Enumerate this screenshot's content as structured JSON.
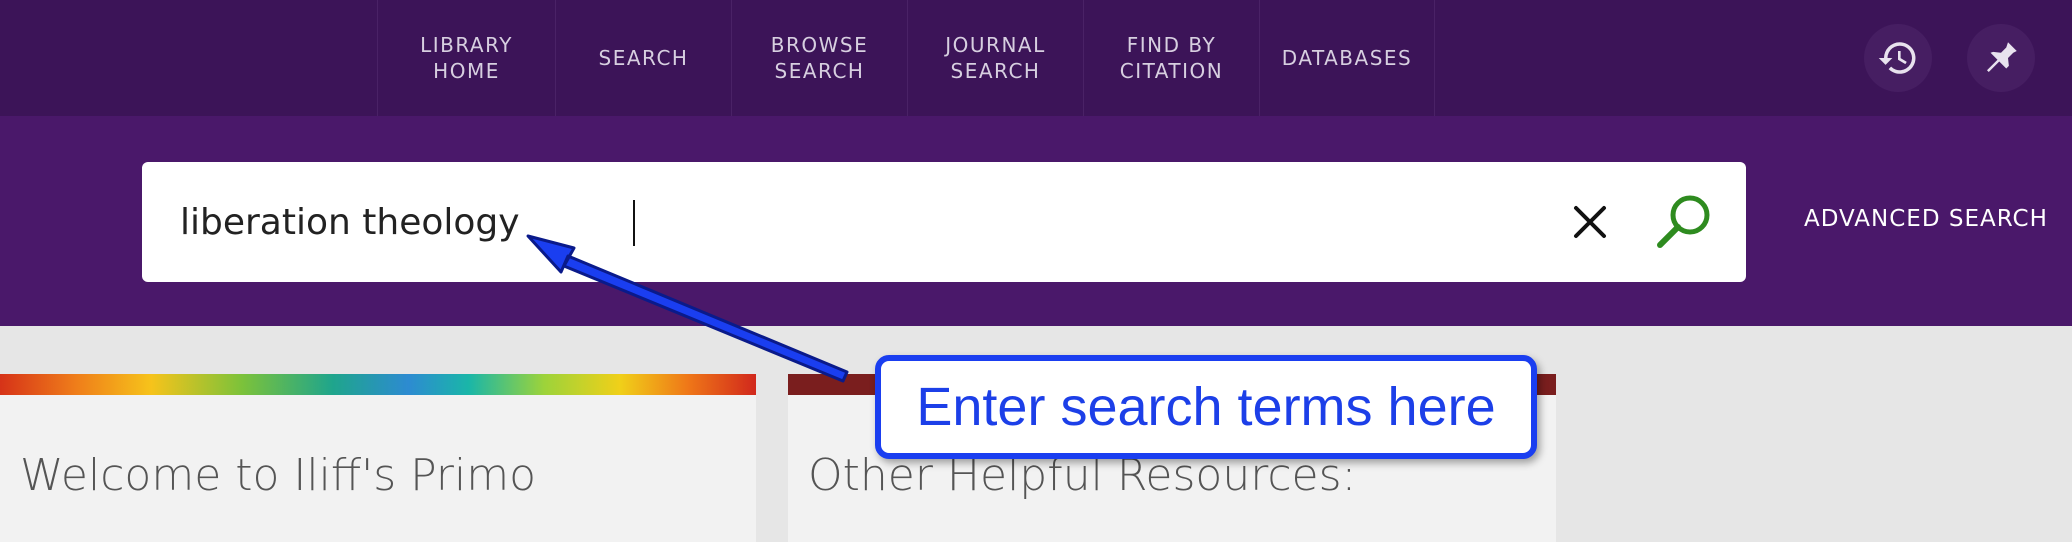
{
  "nav": {
    "items": [
      {
        "label": "LIBRARY\nHOME",
        "name": "nav-library-home"
      },
      {
        "label": "SEARCH",
        "name": "nav-search"
      },
      {
        "label": "BROWSE\nSEARCH",
        "name": "nav-browse-search"
      },
      {
        "label": "JOURNAL\nSEARCH",
        "name": "nav-journal-search"
      },
      {
        "label": "FIND BY\nCITATION",
        "name": "nav-find-by-citation"
      },
      {
        "label": "DATABASES",
        "name": "nav-databases"
      }
    ],
    "icons": [
      "history-icon",
      "pin-icon"
    ]
  },
  "search": {
    "query": "liberation theology",
    "advanced_label": "ADVANCED SEARCH",
    "icons": [
      "close-icon",
      "search-icon"
    ]
  },
  "cards": [
    {
      "title": "Welcome to Iliff's Primo"
    },
    {
      "title": "Other Helpful Resources:"
    }
  ],
  "annotation": {
    "text": "Enter search terms here",
    "color": "#1a3ef0"
  },
  "colors": {
    "nav_bg": "#3c1458",
    "search_band_bg": "#4a186a",
    "search_icon": "#2e8b1f"
  }
}
